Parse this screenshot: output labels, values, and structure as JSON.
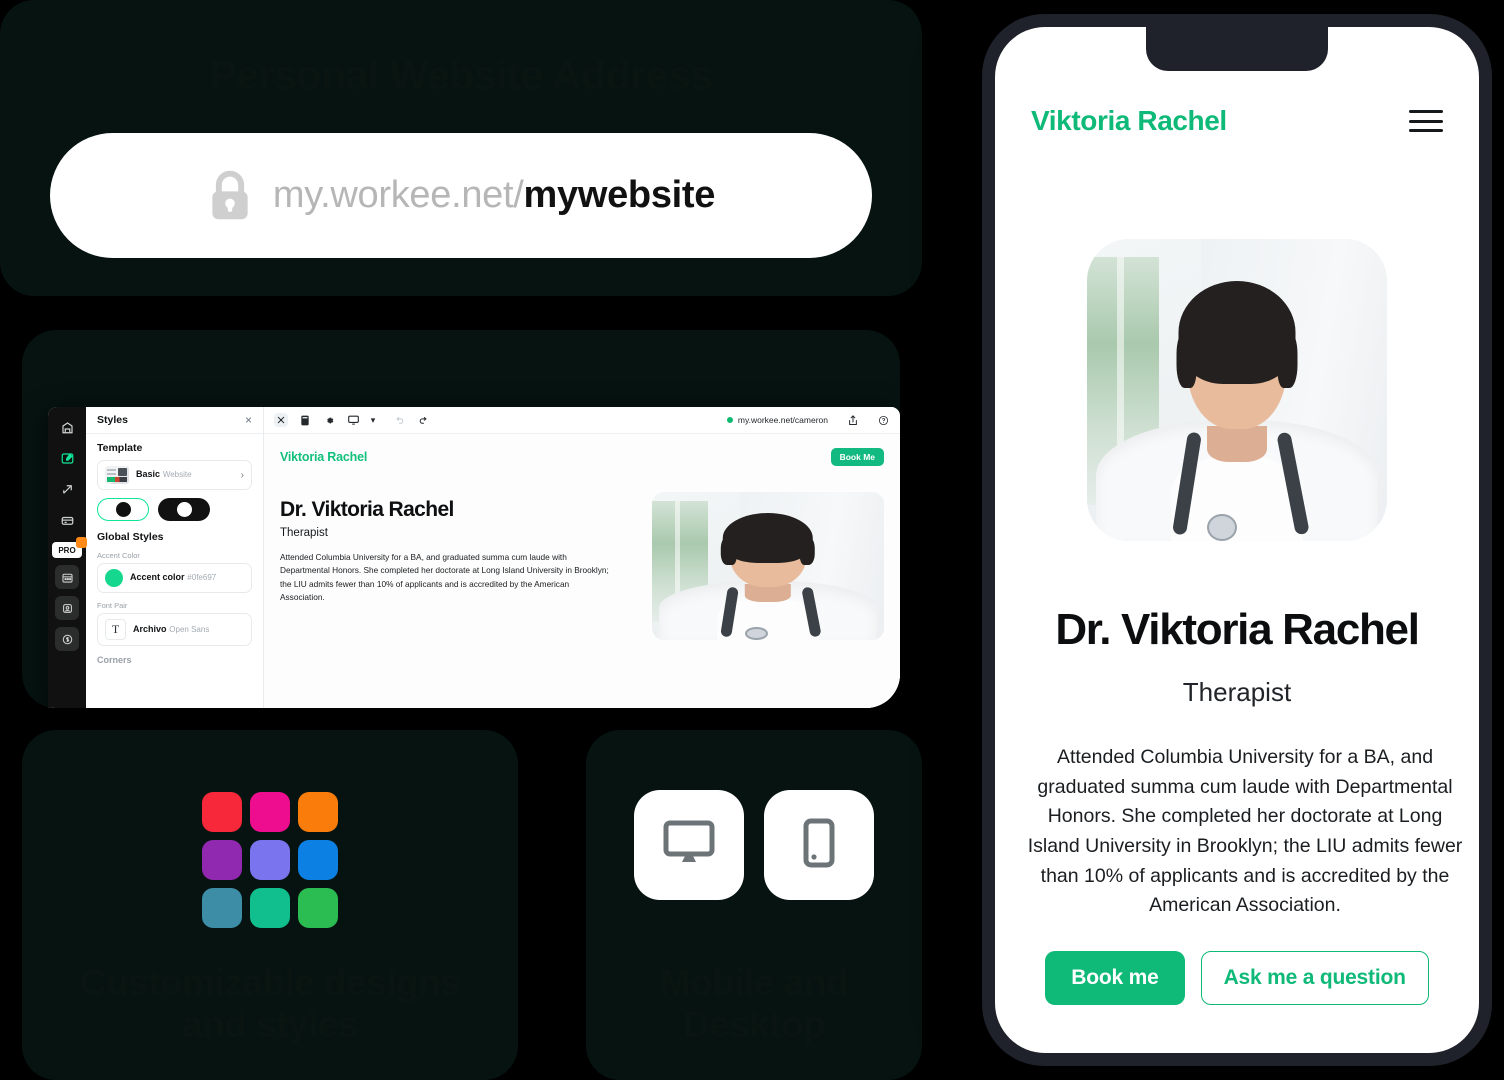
{
  "address_card": {
    "title": "Personal Website Address",
    "lock_icon": "lock-icon",
    "url_domain": "my.workee.net/",
    "url_slug": "mywebsite"
  },
  "editor_card": {
    "rail": {
      "items": [
        {
          "icon": "home-icon",
          "active": false
        },
        {
          "icon": "edit-website-icon",
          "active": true
        },
        {
          "icon": "share-arrow-icon",
          "active": false
        },
        {
          "icon": "card-icon",
          "active": false
        },
        {
          "icon": "pro-badge",
          "label": "PRO",
          "active": false
        },
        {
          "icon": "calendar-icon",
          "active": false
        },
        {
          "icon": "profile-icon",
          "active": false
        },
        {
          "icon": "dollar-icon",
          "active": false
        }
      ]
    },
    "styles_panel": {
      "title": "Styles",
      "close_label": "×",
      "template_heading": "Template",
      "template_name": "Basic",
      "template_type": "Website",
      "template_chevron": "›",
      "theme_light_label": "light-theme",
      "theme_dark_label": "dark-theme",
      "global_styles_heading": "Global Styles",
      "accent_color_label": "Accent Color",
      "accent_name": "Accent color",
      "accent_hex": "#0fe697",
      "font_pair_label": "Font Pair",
      "font_primary": "Archivo",
      "font_secondary": "Open Sans",
      "font_glyph": "T",
      "corners_label": "Corners"
    },
    "toolbar": {
      "icons": [
        "styles-icon",
        "mobile-view-icon",
        "settings-gear-icon",
        "desktop-view-icon",
        "undo-icon",
        "redo-icon"
      ],
      "desktop_caret": "▾",
      "status_dot_color": "#0fb96f",
      "url": "my.workee.net/cameron",
      "share_icon": "share-icon",
      "help_icon": "help-circle-icon"
    },
    "preview": {
      "brand": "Viktoria Rachel",
      "book_button": "Book Me",
      "heading": "Dr. Viktoria Rachel",
      "subheading": "Therapist",
      "bio": "Attended Columbia University for a BA, and graduated summa cum laude with Departmental Honors. She completed her doctorate at Long Island University in Brooklyn; the LIU admits fewer than 10% of applicants and is accredited by the American Association.",
      "photo_alt": "doctor-portrait"
    }
  },
  "designs_card": {
    "caption": "Customizable designs\nand styles",
    "swatches": [
      "#f62839",
      "#ef0d8f",
      "#fa7d0c",
      "#9128b0",
      "#7a74ef",
      "#0d80e4",
      "#3e8da6",
      "#10bf8d",
      "#2bbc52"
    ]
  },
  "devices_card": {
    "caption": "Mobile and\nDesktop",
    "tiles": [
      {
        "icon": "desktop-monitor-icon"
      },
      {
        "icon": "mobile-phone-icon"
      }
    ]
  },
  "phone": {
    "brand": "Viktoria Rachel",
    "menu_icon": "hamburger-menu-icon",
    "photo_alt": "doctor-portrait",
    "name": "Dr. Viktoria Rachel",
    "role": "Therapist",
    "bio": "Attended Columbia University for a BA, and graduated summa cum laude with Departmental Honors. She completed her doctorate at Long Island University in Brooklyn; the LIU admits fewer than 10% of applicants and is accredited by the American Association.",
    "primary_button": "Book me",
    "secondary_button": "Ask me a question"
  },
  "colors": {
    "accent": "#0fe697",
    "accent_dark": "#0fb978",
    "card_bg": "#061310",
    "page_bg": "#000000",
    "phone_frame": "#1f222a"
  }
}
